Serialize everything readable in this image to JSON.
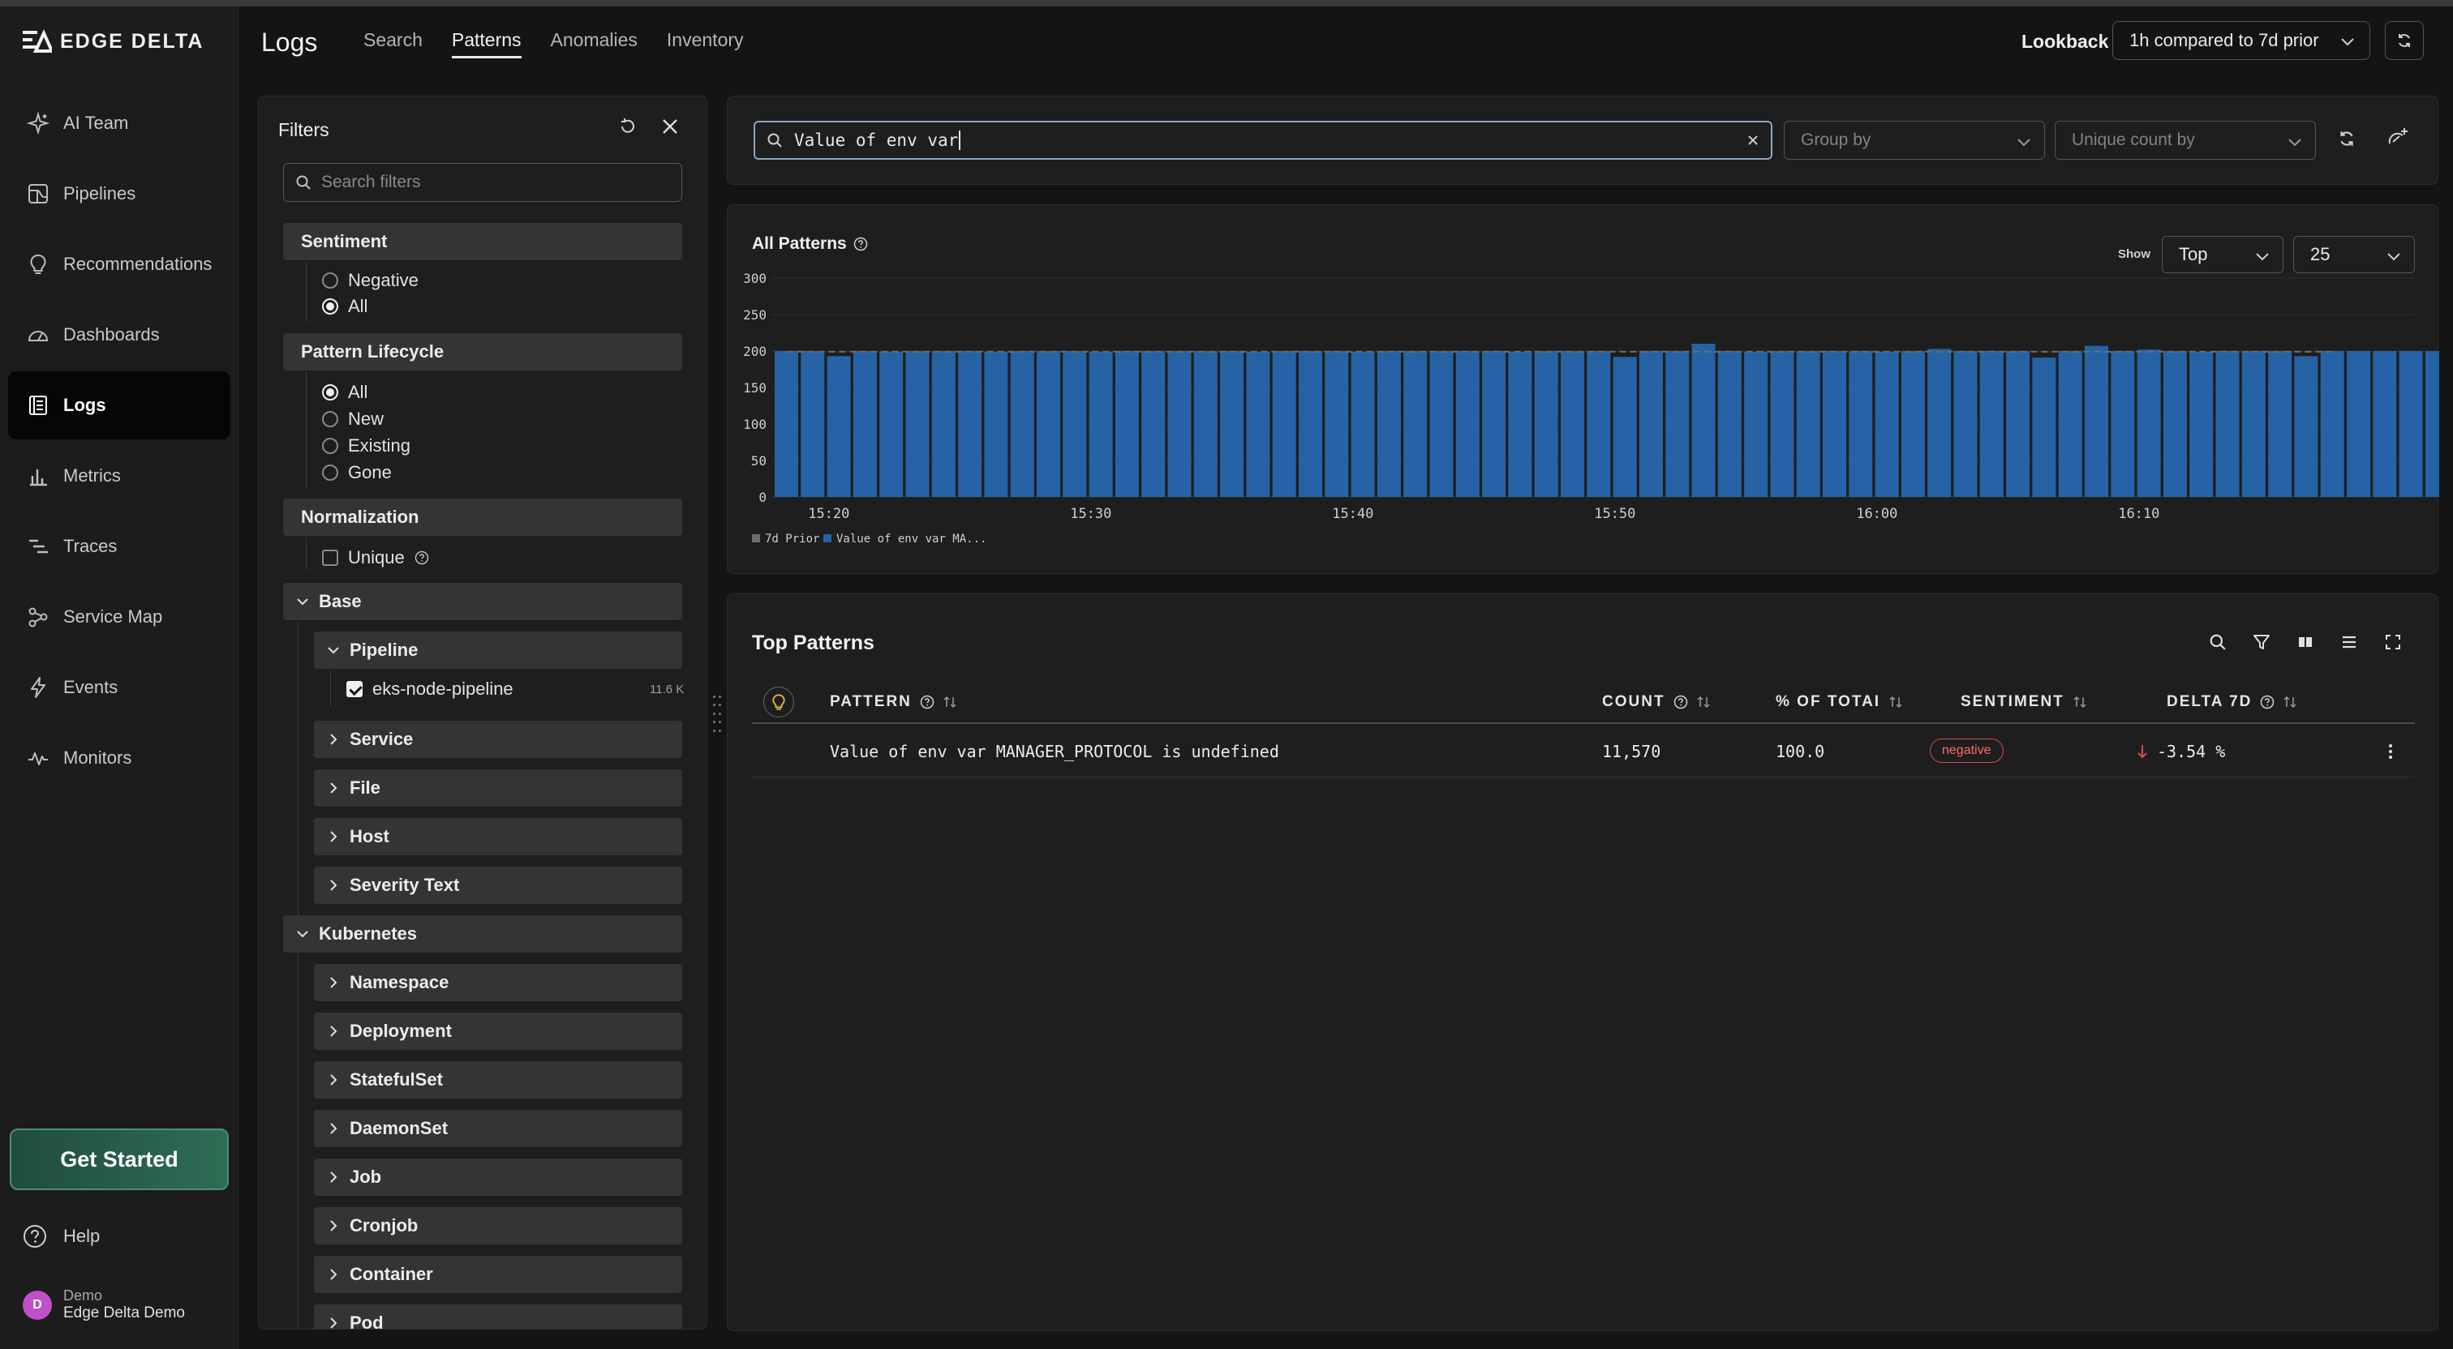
{
  "brand": {
    "name": "EDGE DELTA"
  },
  "sidebar": {
    "items": [
      {
        "label": "AI Team",
        "icon": "sparkle-icon"
      },
      {
        "label": "Pipelines",
        "icon": "pipeline-icon"
      },
      {
        "label": "Recommendations",
        "icon": "lightbulb-icon"
      },
      {
        "label": "Dashboards",
        "icon": "gauge-icon"
      },
      {
        "label": "Logs",
        "icon": "logs-icon",
        "active": true
      },
      {
        "label": "Metrics",
        "icon": "bar-chart-icon"
      },
      {
        "label": "Traces",
        "icon": "traces-icon"
      },
      {
        "label": "Service Map",
        "icon": "graph-icon"
      },
      {
        "label": "Events",
        "icon": "lightning-icon"
      },
      {
        "label": "Monitors",
        "icon": "pulse-icon"
      }
    ],
    "get_started": "Get Started",
    "help": "Help",
    "user": {
      "initial": "D",
      "org": "Demo",
      "name": "Edge Delta Demo"
    }
  },
  "header": {
    "title": "Logs",
    "tabs": [
      {
        "label": "Search"
      },
      {
        "label": "Patterns",
        "active": true
      },
      {
        "label": "Anomalies"
      },
      {
        "label": "Inventory"
      }
    ],
    "lookback_label": "Lookback",
    "lookback_value": "1h compared to 7d prior"
  },
  "filters": {
    "title": "Filters",
    "search_placeholder": "Search filters",
    "sentiment": {
      "label": "Sentiment",
      "options": [
        "Negative",
        "All"
      ],
      "selected": "All"
    },
    "lifecycle": {
      "label": "Pattern Lifecycle",
      "options": [
        "All",
        "New",
        "Existing",
        "Gone"
      ],
      "selected": "All"
    },
    "normalization": {
      "label": "Normalization",
      "unique_label": "Unique",
      "unique_checked": false
    },
    "base": {
      "label": "Base",
      "pipeline": {
        "label": "Pipeline",
        "value": "eks-node-pipeline",
        "count": "11.6 K",
        "checked": true
      },
      "service": "Service",
      "file": "File",
      "host": "Host",
      "severity": "Severity Text"
    },
    "kubernetes": {
      "label": "Kubernetes",
      "namespace": "Namespace",
      "deployment": "Deployment",
      "statefulset": "StatefulSet",
      "daemonset": "DaemonSet",
      "job": "Job",
      "cronjob": "Cronjob",
      "container": "Container",
      "pod": "Pod"
    }
  },
  "query": {
    "value": "Value of env var",
    "group_by_placeholder": "Group by",
    "unique_count_placeholder": "Unique count by"
  },
  "chart_panel": {
    "title": "All Patterns",
    "show_label": "Show",
    "show_value": "Top",
    "limit_value": "25"
  },
  "chart_data": {
    "type": "bar",
    "title": "All Patterns",
    "x_tick_labels": [
      "15:20",
      "15:30",
      "15:40",
      "15:50",
      "16:00",
      "16:10"
    ],
    "x_tick_bar_index": [
      1,
      11,
      21,
      31,
      41,
      51
    ],
    "y_ticks": [
      0,
      50,
      100,
      150,
      200,
      250,
      300
    ],
    "ylim": [
      0,
      300
    ],
    "series": [
      {
        "name": "7d Prior",
        "color": "#6e6e6e",
        "style": "dashed-line",
        "values": [
          199,
          199,
          199,
          199,
          199,
          199,
          199,
          199,
          199,
          199,
          199,
          199,
          199,
          199,
          199,
          199,
          199,
          199,
          199,
          199,
          199,
          199,
          199,
          199,
          199,
          199,
          199,
          199,
          199,
          199,
          199,
          199,
          199,
          199,
          199,
          199,
          199,
          199,
          199,
          199,
          199,
          199,
          199,
          199,
          199,
          199,
          199,
          199,
          199,
          199,
          199,
          199,
          199,
          199,
          199,
          199,
          199,
          199,
          199,
          199
        ]
      },
      {
        "name": "Value of env var MA...",
        "color": "#2563a6",
        "values": [
          200,
          200,
          193,
          200,
          199,
          200,
          200,
          200,
          199,
          200,
          200,
          200,
          199,
          200,
          200,
          200,
          200,
          200,
          199,
          200,
          200,
          200,
          199,
          200,
          200,
          200,
          200,
          200,
          199,
          200,
          200,
          200,
          192,
          200,
          200,
          210,
          200,
          199,
          200,
          200,
          200,
          200,
          199,
          200,
          203,
          200,
          200,
          200,
          191,
          200,
          207,
          200,
          202,
          200,
          199,
          200,
          200,
          200,
          193,
          200,
          200,
          200,
          200,
          200,
          190
        ]
      }
    ],
    "legend_position": "bottom-left",
    "grid": true
  },
  "patterns": {
    "title": "Top Patterns",
    "columns": [
      "PATTERN",
      "COUNT",
      "% OF TOTAI",
      "SENTIMENT",
      "DELTA 7D"
    ],
    "rows": [
      {
        "pattern": "Value of env var MANAGER_PROTOCOL is undefined",
        "count": "11,570",
        "percent": "100.0",
        "sentiment": "negative",
        "delta": "-3.54 %"
      }
    ]
  }
}
